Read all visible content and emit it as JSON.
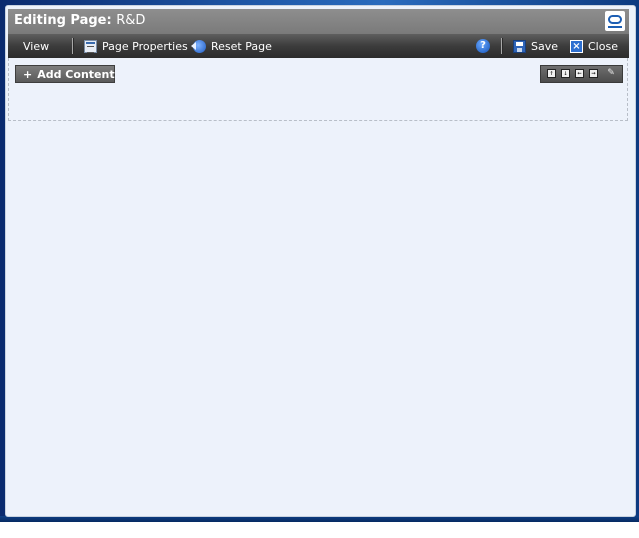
{
  "title_bar": {
    "prefix": "Editing Page:",
    "page_name": "R&D"
  },
  "toolbar": {
    "view_label": "View",
    "page_properties_label": "Page Properties",
    "reset_page_label": "Reset Page",
    "help_glyph": "?",
    "save_label": "Save",
    "close_label": "Close"
  },
  "content": {
    "add_content_label": "Add Content",
    "add_glyph": "+"
  },
  "layout_tools": {
    "buttons": [
      "↑",
      "↓",
      "←",
      "→"
    ],
    "edit_glyph": "✎"
  },
  "icons": {
    "logo": "oracle-logo-icon",
    "page_properties": "page-properties-icon",
    "reset_page": "reset-page-icon",
    "help": "help-icon",
    "save": "save-icon",
    "close": "close-icon"
  },
  "colors": {
    "desktop_blue": "#1f58a8",
    "panel_bg": "#edf2fb",
    "title_bar": "#8e8e8e",
    "toolbar_dark": "#3c3c3c",
    "accent_blue": "#2d6fd0"
  }
}
